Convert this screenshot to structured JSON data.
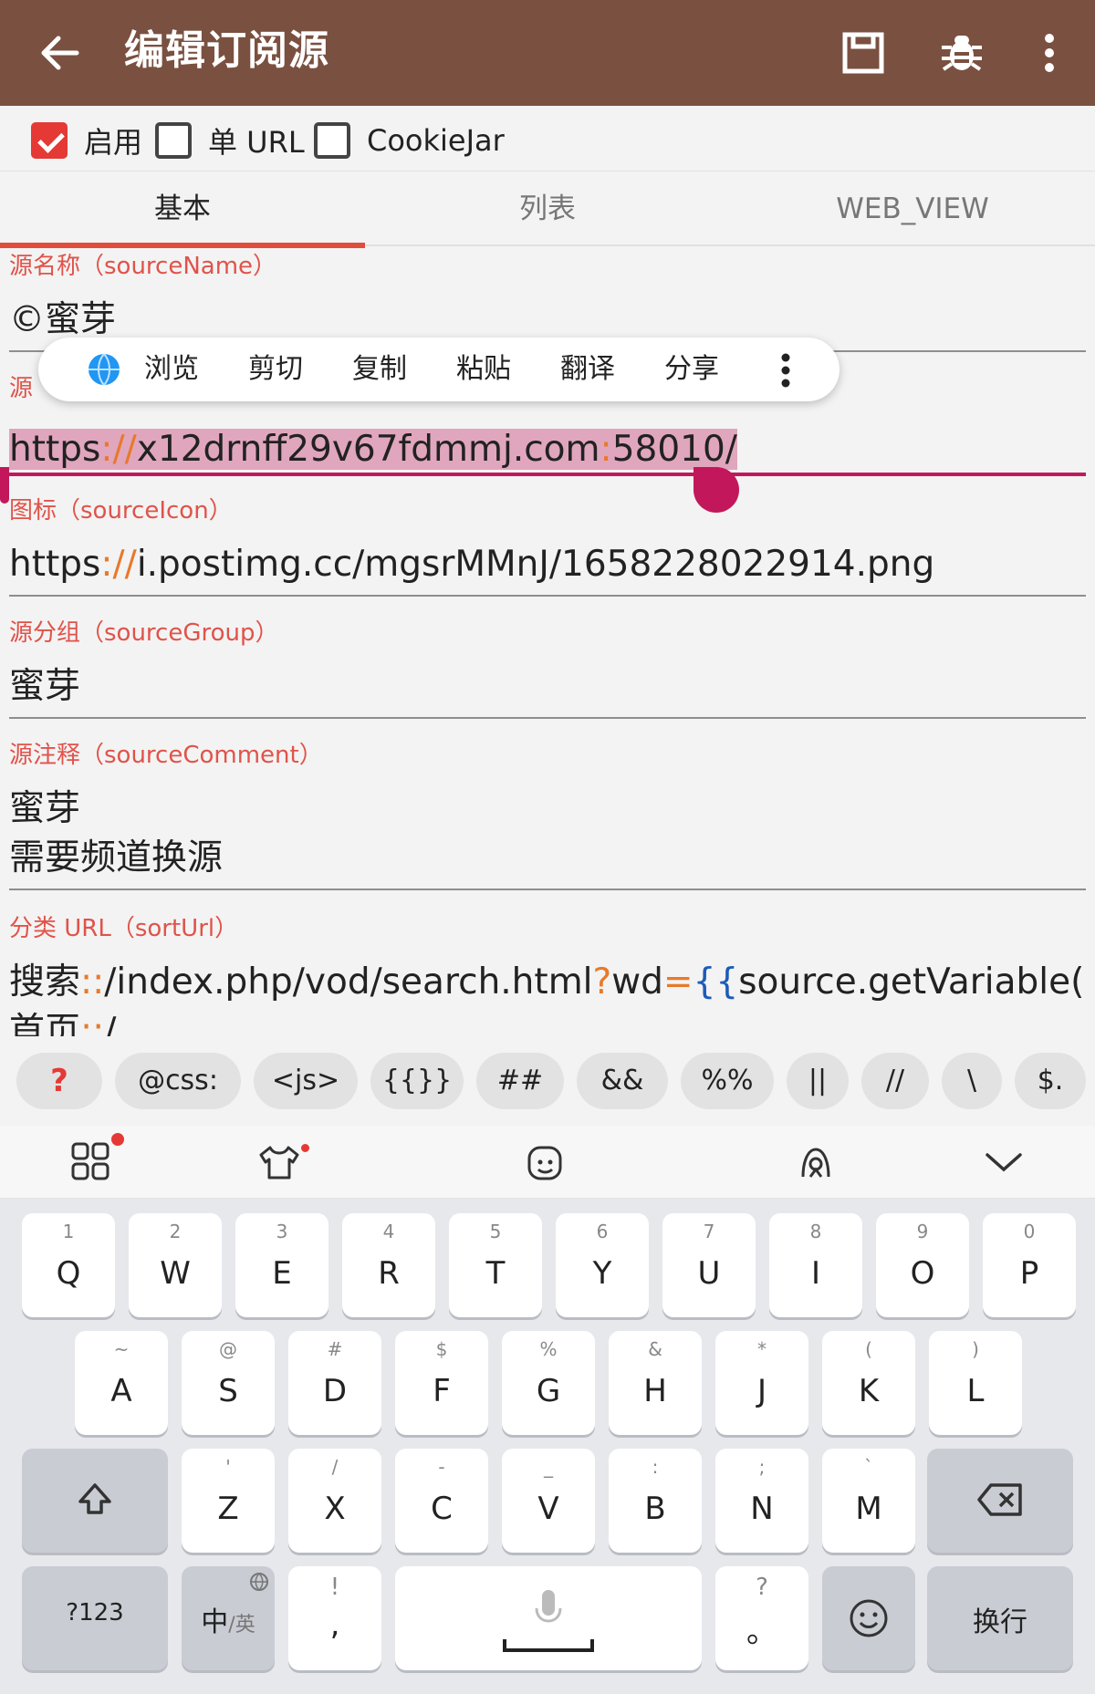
{
  "colors": {
    "appbar": "#7a5040",
    "accent": "#e04e3b",
    "label": "#e0534a",
    "selection": "#e0a6bd",
    "cursor": "#c2185b"
  },
  "appbar": {
    "title": "编辑订阅源",
    "icons": [
      "back-arrow-icon",
      "save-icon",
      "bug-icon",
      "more-vert-icon"
    ]
  },
  "options": [
    {
      "label": "启用",
      "checked": true
    },
    {
      "label": "单 URL",
      "checked": false
    },
    {
      "label": "CookieJar",
      "checked": false
    }
  ],
  "tabs": [
    {
      "label": "基本",
      "active": true
    },
    {
      "label": "列表",
      "active": false
    },
    {
      "label": "WEB_VIEW",
      "active": false
    }
  ],
  "fields": {
    "name": {
      "label": "源名称（sourceName）",
      "value": "©蜜芽"
    },
    "url": {
      "label_visible": "源",
      "value_a": "https",
      "value_b": "://",
      "value_c": "x12drnff29v67fdmmj.com",
      "value_d": ":",
      "value_e": "58010/"
    },
    "icon": {
      "label": "图标（sourceIcon）",
      "value_a": "https",
      "value_b": "://",
      "value_c": "i.postimg.cc/mgsrMMnJ/1658228022914.png"
    },
    "group": {
      "label": "源分组（sourceGroup）",
      "value": "蜜芽"
    },
    "comment": {
      "label": "源注释（sourceComment）",
      "line1": "蜜芽",
      "line2": "需要频道换源"
    },
    "sort": {
      "label": "分类 URL（sortUrl）",
      "p1": "搜索",
      "p2": "::",
      "p3": "/index.php/vod/search.html",
      "p4": "?",
      "p5": "wd",
      "p6": "=",
      "p7": "{{",
      "p8": "source.getVariable()",
      "p9": "}}",
      "line2a": "首页",
      "line2b": "::",
      "line2c": "/"
    }
  },
  "text_toolbar": {
    "items": [
      "浏览",
      "剪切",
      "复制",
      "粘贴",
      "翻译",
      "分享"
    ]
  },
  "symbols": [
    "?",
    "@css:",
    "<js>",
    "{{}}",
    "##",
    "&&",
    "%%",
    "||",
    "//",
    "\\",
    "$."
  ],
  "keyboard": {
    "row1": [
      [
        "1",
        "Q"
      ],
      [
        "2",
        "W"
      ],
      [
        "3",
        "E"
      ],
      [
        "4",
        "R"
      ],
      [
        "5",
        "T"
      ],
      [
        "6",
        "Y"
      ],
      [
        "7",
        "U"
      ],
      [
        "8",
        "I"
      ],
      [
        "9",
        "O"
      ],
      [
        "0",
        "P"
      ]
    ],
    "row2": [
      [
        "~",
        "A"
      ],
      [
        "@",
        "S"
      ],
      [
        "#",
        "D"
      ],
      [
        "$",
        "F"
      ],
      [
        "%",
        "G"
      ],
      [
        "&",
        "H"
      ],
      [
        "*",
        "J"
      ],
      [
        "(",
        "K"
      ],
      [
        ")",
        "L"
      ]
    ],
    "row3": [
      [
        "'",
        "Z"
      ],
      [
        "/",
        "X"
      ],
      [
        "-",
        "C"
      ],
      [
        "_",
        "V"
      ],
      [
        ":",
        "B"
      ],
      [
        ";",
        "N"
      ],
      [
        "`",
        "M"
      ]
    ],
    "num_label": "?123",
    "lang_main": "中",
    "lang_sub": "/英",
    "comma_hint": "!",
    "comma": ",",
    "period_hint": "?",
    "period": "。",
    "enter_label": "换行"
  }
}
